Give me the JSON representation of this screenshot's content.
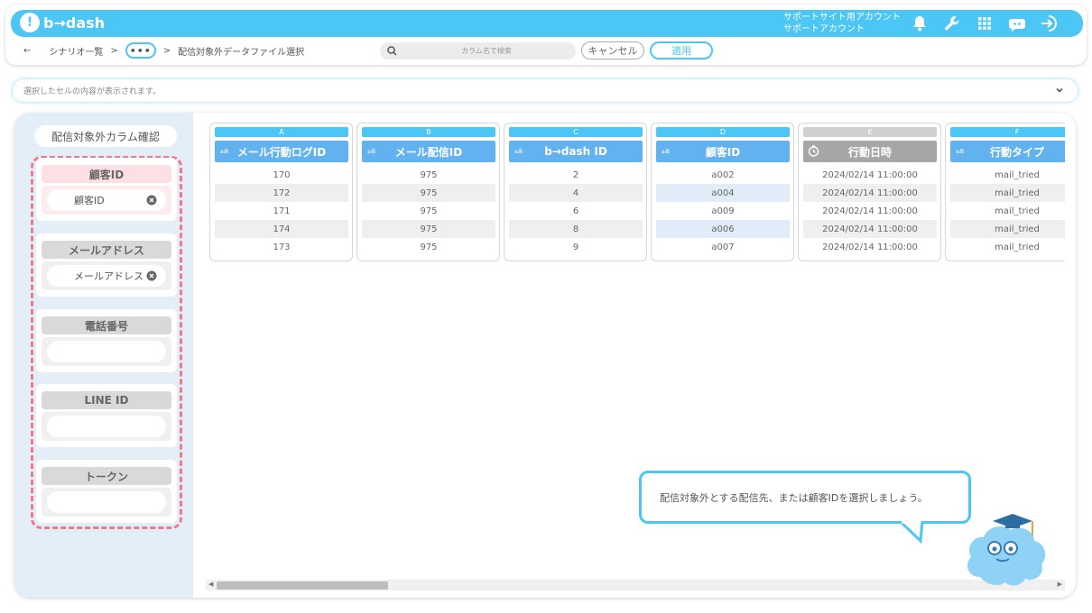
{
  "header": {
    "logo": "b→dash",
    "account_line1": "サポートサイト用アカウント",
    "account_line2": "サポートアカウント",
    "icons": [
      "bell-icon",
      "wrench-icon",
      "grid-icon",
      "bot-icon",
      "logout-icon"
    ]
  },
  "breadcrumb": {
    "back": "←",
    "item1": "シナリオ一覧",
    "sep": ">",
    "more": "•••",
    "current": "配信対象外データファイル選択"
  },
  "search": {
    "placeholder": "カラム名で検索"
  },
  "actions": {
    "cancel": "キャンセル",
    "apply": "適用"
  },
  "cell_preview": {
    "text": "選択したセルの内容が表示されます。"
  },
  "sidebar": {
    "title": "配信対象外カラム確認",
    "groups": [
      {
        "label": "顧客ID",
        "value": "顧客ID",
        "active": true
      },
      {
        "label": "メールアドレス",
        "value": "メールアドレス",
        "active": false
      },
      {
        "label": "電話番号",
        "value": "",
        "active": false
      },
      {
        "label": "LINE ID",
        "value": "",
        "active": false
      },
      {
        "label": "トークン",
        "value": "",
        "active": false
      }
    ]
  },
  "table": {
    "type_badge": "aあ",
    "columns": [
      {
        "letter": "A",
        "name": "メール行動ログID",
        "kind": "text",
        "cells": [
          "170",
          "172",
          "171",
          "174",
          "173"
        ]
      },
      {
        "letter": "B",
        "name": "メール配信ID",
        "kind": "text",
        "cells": [
          "975",
          "975",
          "975",
          "975",
          "975"
        ]
      },
      {
        "letter": "C",
        "name": "b→dash ID",
        "kind": "text",
        "cells": [
          "2",
          "4",
          "6",
          "8",
          "9"
        ]
      },
      {
        "letter": "D",
        "name": "顧客ID",
        "kind": "text",
        "cells": [
          "a002",
          "a004",
          "a009",
          "a006",
          "a007"
        ],
        "highlighted": true
      },
      {
        "letter": "E",
        "name": "行動日時",
        "kind": "datetime",
        "cells": [
          "2024/02/14 11:00:00",
          "2024/02/14 11:00:00",
          "2024/02/14 11:00:00",
          "2024/02/14 11:00:00",
          "2024/02/14 11:00:00"
        ]
      },
      {
        "letter": "F",
        "name": "行動タイプ",
        "kind": "text",
        "cells": [
          "mail_tried",
          "mail_tried",
          "mail_tried",
          "mail_tried",
          "mail_tried"
        ]
      }
    ]
  },
  "tip": {
    "text": "配信対象外とする配信先、または顧客IDを選択しましょう。"
  },
  "colors": {
    "accent": "#4cc6f4",
    "header_blue": "#62b2ef",
    "header_gray": "#a6a6a6",
    "dash_red": "#f07a86",
    "sidebar_bg": "#e4eef8"
  }
}
